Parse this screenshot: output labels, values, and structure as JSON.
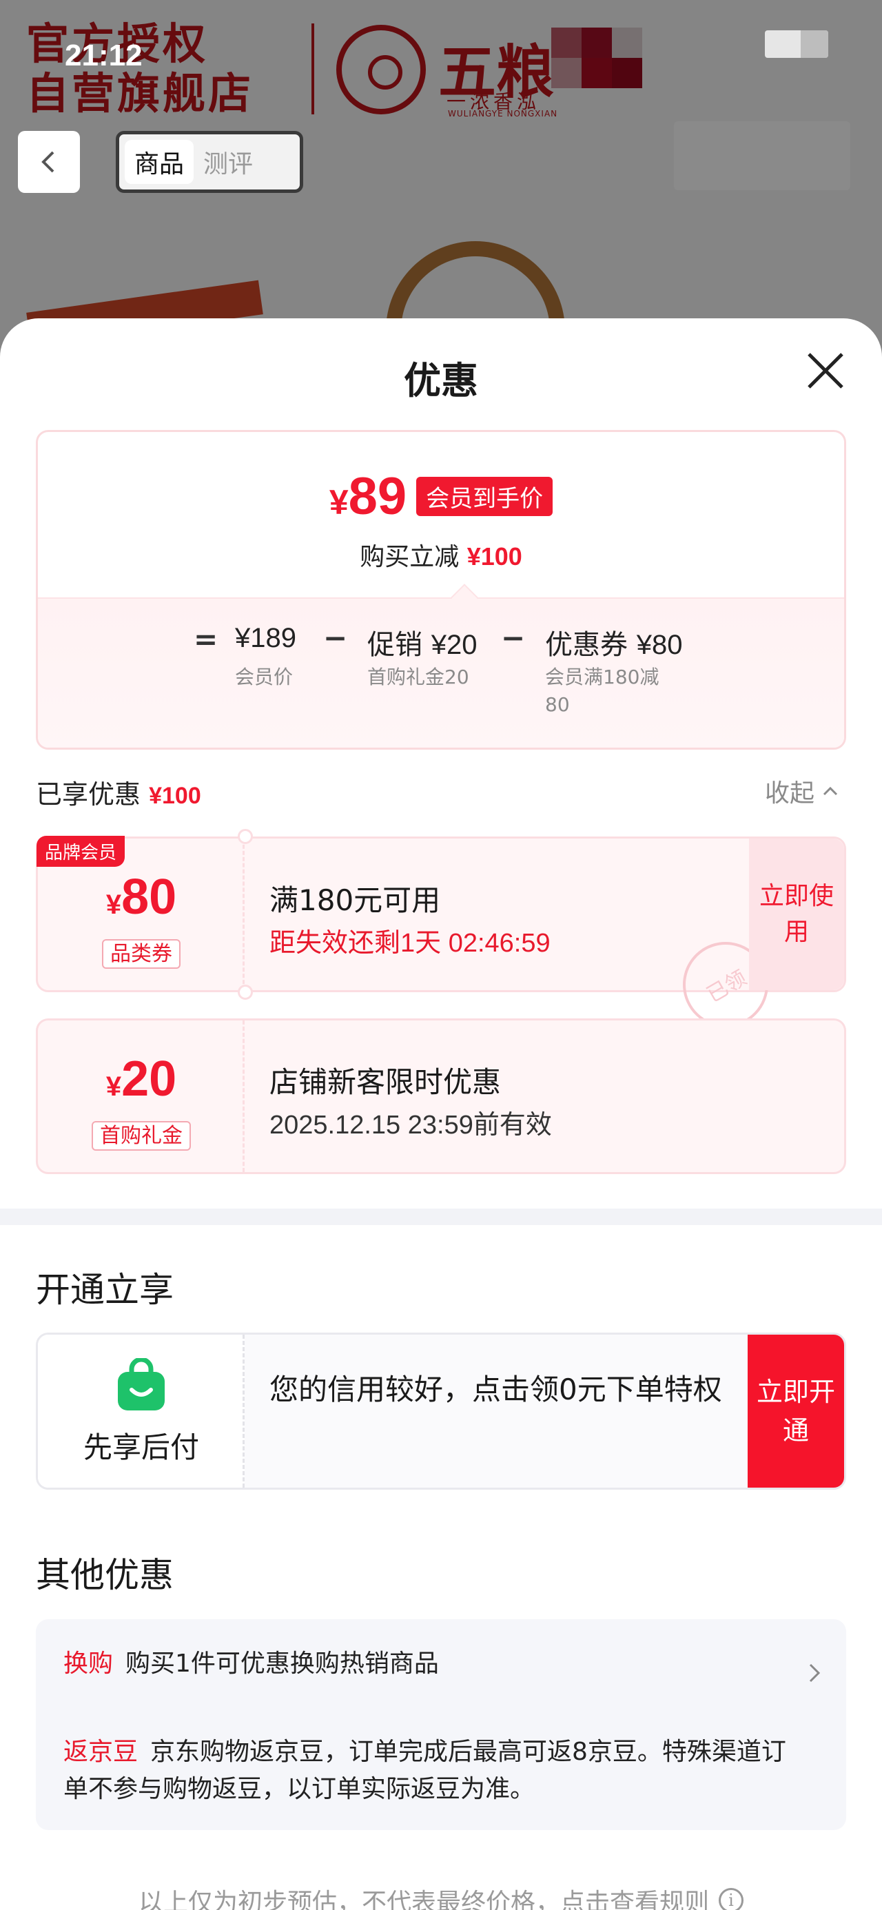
{
  "status_bar": {
    "time": "21:12"
  },
  "background": {
    "banner_line1": "官方授权",
    "banner_line2": "自营旗舰店",
    "brand_name": "五粮",
    "brand_sub": "一浓香泓",
    "brand_en": "WULIANGYE NONGXIAN",
    "tabs": [
      {
        "label": "商品",
        "active": true
      },
      {
        "label": "测评",
        "active": false
      }
    ]
  },
  "sheet": {
    "title": "优惠",
    "summary": {
      "currency": "¥",
      "final_price": "89",
      "badge": "会员到手价",
      "reduce_label": "购买立减",
      "reduce_value": "¥100",
      "formula": {
        "equals": "=",
        "minus": "−",
        "items": [
          {
            "label": "",
            "value": "¥189",
            "sub": "会员价"
          },
          {
            "label": "促销",
            "value": "¥20",
            "sub": "首购礼金20"
          },
          {
            "label": "优惠券",
            "value": "¥80",
            "sub": "会员满180减80"
          }
        ]
      }
    },
    "enjoyed": {
      "label": "已享优惠",
      "value": "¥100",
      "collapse": "收起"
    },
    "coupons": [
      {
        "brand_tag": "品牌会员",
        "currency": "¥",
        "amount": "80",
        "tag": "品类券",
        "title": "满180元可用",
        "desc": "距失效还剩1天 02:46:59",
        "button": "立即使用",
        "stamp": "已领"
      },
      {
        "currency": "¥",
        "amount": "20",
        "tag": "首购礼金",
        "title": "店铺新客限时优惠",
        "desc": "2025.12.15 23:59前有效"
      }
    ],
    "open_section": {
      "title": "开通立享",
      "card_label": "先享后付",
      "card_text": "您的信用较好，点击领0元下单特权",
      "button": "立即开通"
    },
    "other_section": {
      "title": "其他优惠",
      "rows": [
        {
          "tag": "换购",
          "text": "购买1件可优惠换购热销商品"
        },
        {
          "tag": "返京豆",
          "text": "京东购物返京豆，订单完成后最高可返8京豆。特殊渠道订单不参与购物返豆，以订单实际返豆为准。"
        }
      ]
    },
    "footnote": "以上仅为初步预估，不代表最终价格，点击查看规则"
  },
  "colors": {
    "accent": "#f0192f",
    "brand_red": "#c4161c",
    "pay_green": "#1ec26a"
  }
}
